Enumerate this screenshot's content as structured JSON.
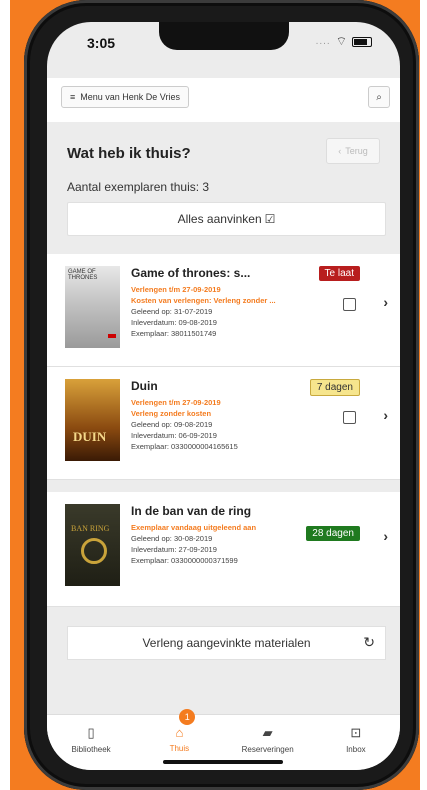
{
  "status": {
    "time": "3:05"
  },
  "header": {
    "menu_label": "Menu van Henk De Vries"
  },
  "page": {
    "title": "Wat heb ik thuis?",
    "back_label": "Terug",
    "count_text": "Aantal exemplaren thuis: 3",
    "check_all_label": "Alles aanvinken"
  },
  "books": [
    {
      "title": "Game of thrones: s...",
      "orange1": "Verlengen t/m 27-09-2019",
      "orange2": "Kosten van verlengen: Verleng zonder ...",
      "loaned": "Geleend op: 31-07-2019",
      "due": "Inleverdatum: 09-08-2019",
      "copy": "Exemplaar: 38011501749",
      "badge": "Te laat",
      "cover_text": "GAME OF THRONES"
    },
    {
      "title": "Duin",
      "orange1": "Verlengen t/m 27-09-2019",
      "orange2": "Verleng zonder kosten",
      "loaned": "Geleend op: 09-08-2019",
      "due": "Inleverdatum: 06-09-2019",
      "copy": "Exemplaar: 0330000004165615",
      "badge": "7 dagen",
      "cover_text": "DUIN"
    },
    {
      "title": "In de ban van de ring",
      "orange1": "Exemplaar vandaag uitgeleend aan",
      "loaned": "Geleend op: 30-08-2019",
      "due": "Inleverdatum: 27-09-2019",
      "copy": "Exemplaar: 0330000000371599",
      "badge": "28 dagen",
      "cover_text": "BAN RING"
    }
  ],
  "renew_label": "Verleng aangevinkte materialen",
  "tabs": [
    {
      "label": "Bibliotheek"
    },
    {
      "label": "Thuis",
      "badge": "1"
    },
    {
      "label": "Reserveringen"
    },
    {
      "label": "Inbox"
    }
  ],
  "colors": {
    "accent": "#f47c20",
    "late": "#b81e1e",
    "warning": "#f6e58d",
    "ok": "#1f7a1f"
  }
}
